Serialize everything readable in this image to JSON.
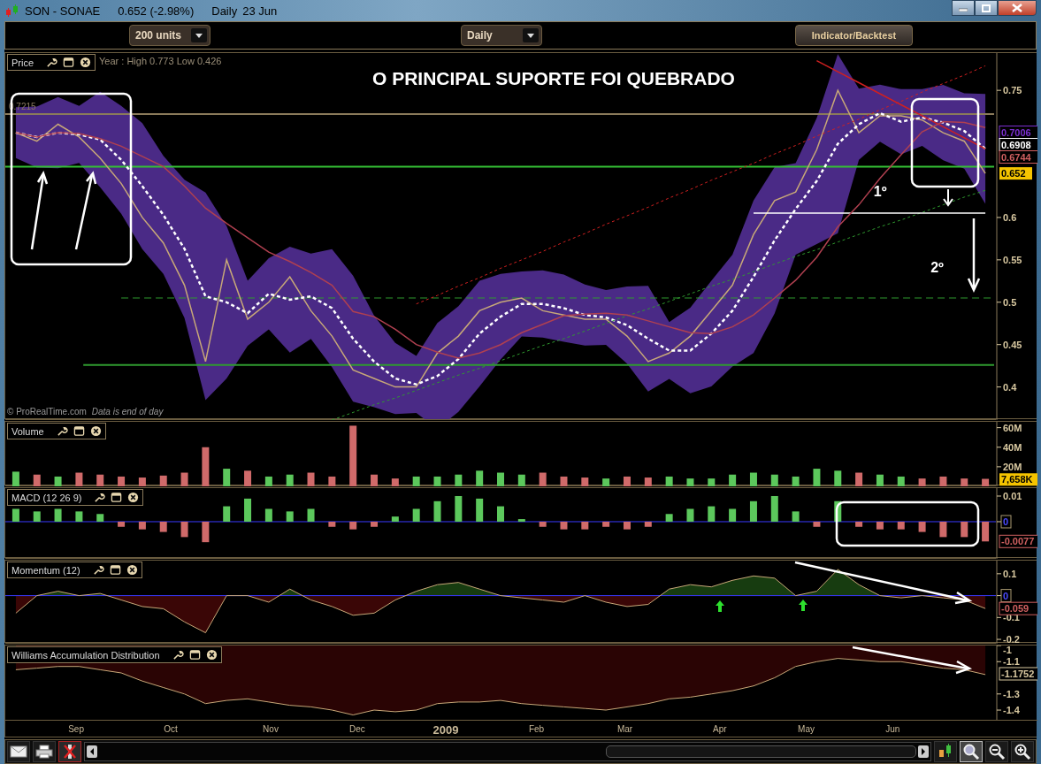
{
  "window": {
    "title": "SON - SONAE",
    "quote": "0.652 (-2.98%)",
    "period": "Daily",
    "date": "23 Jun"
  },
  "toolbar": {
    "units_dropdown": "200 units",
    "period_dropdown": "Daily",
    "indicator_button": "Indicator/Backtest"
  },
  "price_panel": {
    "info": "Year : High 0.773 Low 0.426",
    "headline": "O PRINCIPAL SUPORTE FOI QUEBRADO",
    "level_label": "0.7215",
    "credit": "© ProRealTime.com",
    "credit_note": "Data is end of day",
    "axis_labels": [
      {
        "text": "0.7006",
        "kind": "outline",
        "color": "#7b2fd0"
      },
      {
        "text": "0.6908",
        "kind": "outline",
        "color": "#ffffff"
      },
      {
        "text": "0.6744",
        "kind": "outline",
        "color": "#d06060"
      },
      {
        "text": "0.652",
        "kind": "filled",
        "color": "#f5c400"
      }
    ],
    "chart_data": {
      "type": "line",
      "ylim": [
        0.361,
        0.794
      ],
      "yticks": [
        0.75,
        0.6,
        0.55,
        0.5,
        0.45,
        0.4
      ],
      "categories": [
        null,
        null,
        null,
        null,
        null,
        null,
        null,
        null,
        null,
        null,
        null,
        null,
        null,
        null,
        null,
        null,
        null,
        null,
        null,
        null,
        null,
        null,
        null,
        null,
        null,
        null,
        null,
        null,
        null,
        null,
        null,
        null,
        null,
        null,
        null,
        null,
        null,
        null,
        null,
        null,
        null,
        null,
        null,
        null,
        null,
        null,
        null
      ],
      "series": [
        {
          "name": "Price",
          "color": "#c8a878",
          "values": [
            0.7,
            0.69,
            0.71,
            0.695,
            0.67,
            0.64,
            0.6,
            0.57,
            0.52,
            0.43,
            0.55,
            0.48,
            0.5,
            0.53,
            0.49,
            0.46,
            0.42,
            0.41,
            0.4,
            0.4,
            0.44,
            0.46,
            0.49,
            0.5,
            0.505,
            0.49,
            0.485,
            0.48,
            0.48,
            0.46,
            0.43,
            0.44,
            0.46,
            0.49,
            0.52,
            0.58,
            0.62,
            0.63,
            0.68,
            0.75,
            0.7,
            0.72,
            0.72,
            0.715,
            0.7,
            0.69,
            0.652
          ]
        },
        {
          "color": "#ffffff",
          "line_style": "dashed",
          "values": [
            0.7,
            0.695,
            0.7,
            0.698,
            0.692,
            0.668,
            0.637,
            0.603,
            0.563,
            0.507,
            0.5,
            0.487,
            0.51,
            0.503,
            0.507,
            0.493,
            0.457,
            0.43,
            0.41,
            0.403,
            0.413,
            0.433,
            0.463,
            0.483,
            0.498,
            0.498,
            0.493,
            0.485,
            0.482,
            0.473,
            0.457,
            0.443,
            0.443,
            0.463,
            0.49,
            0.53,
            0.573,
            0.61,
            0.643,
            0.687,
            0.71,
            0.723,
            0.713,
            0.718,
            0.712,
            0.702,
            0.681
          ]
        },
        {
          "color": "#d02020",
          "line_style": "dotted",
          "values": [
            null,
            null,
            null,
            null,
            null,
            null,
            null,
            null,
            null,
            null,
            null,
            null,
            null,
            null,
            null,
            null,
            null,
            null,
            null,
            0.498,
            0.508,
            0.519,
            0.529,
            0.54,
            0.55,
            0.56,
            0.571,
            0.581,
            0.592,
            0.602,
            0.612,
            0.623,
            0.633,
            0.644,
            0.654,
            0.664,
            0.675,
            0.685,
            0.696,
            0.706,
            0.716,
            0.727,
            0.737,
            0.748,
            0.758,
            0.768,
            0.779
          ]
        },
        {
          "color": "#2f9a2f",
          "line_style": "dotted",
          "values": [
            null,
            null,
            null,
            null,
            null,
            null,
            null,
            null,
            null,
            null,
            null,
            null,
            null,
            null,
            null,
            0.361,
            0.37,
            0.379,
            0.387,
            0.396,
            0.405,
            0.414,
            0.422,
            0.431,
            0.44,
            0.449,
            0.457,
            0.466,
            0.475,
            0.484,
            0.492,
            0.501,
            0.51,
            0.519,
            0.527,
            0.536,
            0.545,
            0.554,
            0.562,
            0.571,
            0.58,
            0.589,
            0.597,
            0.606,
            0.615,
            0.624,
            0.632
          ]
        },
        {
          "color": "#d02020",
          "line_style": "solid",
          "values": [
            null,
            null,
            null,
            null,
            null,
            null,
            null,
            null,
            null,
            null,
            null,
            null,
            null,
            null,
            null,
            null,
            null,
            null,
            null,
            null,
            null,
            null,
            null,
            null,
            null,
            null,
            null,
            null,
            null,
            null,
            null,
            null,
            null,
            null,
            null,
            null,
            null,
            null,
            0.785,
            0.772,
            0.759,
            0.746,
            0.733,
            0.72,
            0.707,
            0.694,
            0.681
          ]
        },
        {
          "color": "#ffffff",
          "line_style": "solid",
          "values": [
            null,
            null,
            null,
            null,
            null,
            null,
            null,
            null,
            null,
            null,
            null,
            null,
            null,
            null,
            null,
            null,
            null,
            null,
            null,
            null,
            null,
            null,
            null,
            null,
            null,
            null,
            null,
            null,
            null,
            null,
            null,
            null,
            null,
            null,
            null,
            0.605,
            0.605,
            0.605,
            0.605,
            0.605,
            0.605,
            0.605,
            0.605,
            0.605,
            0.605,
            0.605,
            0.605
          ]
        },
        {
          "color": "#b04050",
          "line_style": "solid",
          "values": [
            0.7,
            0.695,
            0.7,
            0.699,
            0.693,
            0.684,
            0.672,
            0.66,
            0.637,
            0.611,
            0.593,
            0.576,
            0.559,
            0.548,
            0.535,
            0.52,
            0.489,
            0.483,
            0.468,
            0.45,
            0.441,
            0.434,
            0.44,
            0.45,
            0.464,
            0.474,
            0.484,
            0.486,
            0.487,
            0.485,
            0.478,
            0.471,
            0.464,
            0.463,
            0.471,
            0.485,
            0.505,
            0.526,
            0.553,
            0.589,
            0.615,
            0.646,
            0.674,
            0.701,
            0.713,
            0.712,
            0.706
          ]
        }
      ],
      "ref_lines": [
        {
          "axis": "y",
          "value": 0.722,
          "color": "#8a7a5a"
        },
        {
          "axis": "y",
          "value": 0.66,
          "color": "#35c035"
        },
        {
          "axis": "y",
          "value": 0.505,
          "color": "#2f9a2f",
          "line_style": "dashed"
        },
        {
          "axis": "y",
          "value": 0.426,
          "color": "#2f9a2f"
        }
      ],
      "annotations": [
        "1º",
        "2º"
      ]
    }
  },
  "volume_panel": {
    "axis_labels": [
      {
        "text": "7,658K",
        "kind": "filled",
        "color": "#f5c400"
      }
    ],
    "chart_data": {
      "type": "bar",
      "ylim": [
        0,
        66
      ],
      "yticks": [
        {
          "value": 60,
          "label": "60M"
        },
        {
          "value": 40,
          "label": "40M"
        },
        {
          "value": 20,
          "label": "20M"
        }
      ],
      "categories": [
        null,
        null,
        null,
        null,
        null,
        null,
        null,
        null,
        null,
        null,
        null,
        null,
        null,
        null,
        null,
        null,
        null,
        null,
        null,
        null,
        null,
        null,
        null,
        null,
        null,
        null,
        null,
        null,
        null,
        null,
        null,
        null,
        null,
        null,
        null,
        null,
        null,
        null,
        null,
        null,
        null,
        null,
        null,
        null,
        null,
        null,
        null
      ],
      "series": [
        {
          "name": "Volume",
          "values": [
            15,
            12,
            10,
            14,
            12,
            10,
            9,
            11,
            14,
            40,
            18,
            16,
            10,
            12,
            14,
            10,
            62,
            12,
            8,
            10,
            10,
            12,
            16,
            14,
            12,
            14,
            10,
            9,
            8,
            10,
            9,
            10,
            8,
            8,
            12,
            14,
            12,
            10,
            18,
            16,
            14,
            12,
            10,
            8,
            10,
            8,
            7.658
          ]
        }
      ]
    }
  },
  "macd_panel": {
    "axis_labels": [
      {
        "text": "-0.0077",
        "kind": "outline",
        "color": "#d06060"
      }
    ],
    "chart_data": {
      "type": "bar",
      "ylim": [
        -0.0145,
        0.0131
      ],
      "yticks": [
        0.01,
        0
      ],
      "ref_lines": [
        {
          "axis": "y",
          "value": 0,
          "color": "#3a3aff"
        }
      ],
      "categories": [
        null,
        null,
        null,
        null,
        null,
        null,
        null,
        null,
        null,
        null,
        null,
        null,
        null,
        null,
        null,
        null,
        null,
        null,
        null,
        null,
        null,
        null,
        null,
        null,
        null,
        null,
        null,
        null,
        null,
        null,
        null,
        null,
        null,
        null,
        null,
        null,
        null,
        null,
        null,
        null,
        null,
        null,
        null,
        null,
        null,
        null,
        null
      ],
      "series": [
        {
          "name": "MACD (12 26 9)",
          "values": [
            0.005,
            0.004,
            0.005,
            0.004,
            0.003,
            -0.002,
            -0.003,
            -0.004,
            -0.006,
            -0.008,
            0.006,
            0.009,
            0.005,
            0.004,
            0.005,
            -0.002,
            -0.003,
            -0.002,
            0.002,
            0.005,
            0.008,
            0.01,
            0.009,
            0.006,
            0.001,
            -0.002,
            -0.003,
            -0.003,
            -0.002,
            -0.003,
            -0.002,
            0.003,
            0.005,
            0.006,
            0.005,
            0.008,
            0.01,
            0.004,
            -0.002,
            0.008,
            -0.002,
            -0.003,
            -0.003,
            -0.004,
            -0.006,
            -0.006,
            -0.0077
          ]
        }
      ]
    }
  },
  "momentum_panel": {
    "axis_labels": [
      {
        "text": "-0.059",
        "kind": "outline",
        "color": "#d06060"
      }
    ],
    "chart_data": {
      "type": "area",
      "ylim": [
        -0.22,
        0.16
      ],
      "yticks": [
        0.1,
        0,
        -0.1,
        -0.2
      ],
      "ref_lines": [
        {
          "axis": "y",
          "value": 0,
          "color": "#3a3aff"
        }
      ],
      "categories": [
        null,
        null,
        null,
        null,
        null,
        null,
        null,
        null,
        null,
        null,
        null,
        null,
        null,
        null,
        null,
        null,
        null,
        null,
        null,
        null,
        null,
        null,
        null,
        null,
        null,
        null,
        null,
        null,
        null,
        null,
        null,
        null,
        null,
        null,
        null,
        null,
        null,
        null,
        null,
        null,
        null,
        null,
        null,
        null,
        null,
        null,
        null
      ],
      "series": [
        {
          "name": "Momentum (12)",
          "values": [
            -0.08,
            0.0,
            0.02,
            0.0,
            0.01,
            -0.02,
            -0.05,
            -0.06,
            -0.12,
            -0.17,
            0.0,
            0.0,
            -0.03,
            0.03,
            -0.02,
            -0.05,
            -0.09,
            -0.08,
            -0.02,
            0.02,
            0.05,
            0.06,
            0.03,
            0.0,
            -0.01,
            -0.02,
            -0.03,
            0.0,
            -0.03,
            -0.05,
            -0.04,
            0.03,
            0.05,
            0.04,
            0.07,
            0.09,
            0.08,
            0.0,
            0.02,
            0.12,
            0.05,
            0.0,
            -0.01,
            0.0,
            -0.01,
            -0.02,
            -0.059
          ]
        }
      ]
    }
  },
  "williams_panel": {
    "axis_labels": [
      {
        "text": "-1.1752",
        "kind": "outline",
        "color": "#d8c8a0"
      }
    ],
    "chart_data": {
      "type": "area",
      "ylim": [
        -1.46,
        -1.0
      ],
      "yticks": [
        -1,
        -1.1,
        -1.3,
        -1.4
      ],
      "categories": [
        null,
        null,
        null,
        null,
        null,
        null,
        null,
        null,
        null,
        null,
        null,
        null,
        null,
        null,
        null,
        null,
        null,
        null,
        null,
        null,
        null,
        null,
        null,
        null,
        null,
        null,
        null,
        null,
        null,
        null,
        null,
        null,
        null,
        null,
        null,
        null,
        null,
        null,
        null,
        null,
        null,
        null,
        null,
        null,
        null,
        null,
        null
      ],
      "series": [
        {
          "name": "Williams Accumulation Distribution",
          "values": [
            -1.15,
            -1.14,
            -1.13,
            -1.13,
            -1.15,
            -1.17,
            -1.22,
            -1.26,
            -1.3,
            -1.36,
            -1.34,
            -1.33,
            -1.35,
            -1.37,
            -1.38,
            -1.4,
            -1.43,
            -1.4,
            -1.41,
            -1.4,
            -1.36,
            -1.35,
            -1.35,
            -1.34,
            -1.36,
            -1.37,
            -1.38,
            -1.39,
            -1.4,
            -1.38,
            -1.36,
            -1.33,
            -1.32,
            -1.3,
            -1.28,
            -1.25,
            -1.2,
            -1.13,
            -1.1,
            -1.08,
            -1.09,
            -1.1,
            -1.1,
            -1.12,
            -1.14,
            -1.15,
            -1.18
          ]
        }
      ]
    }
  },
  "time_axis": [
    {
      "label": "Sep",
      "kind": "month"
    },
    {
      "label": "Oct",
      "kind": "month"
    },
    {
      "label": "Nov",
      "kind": "month"
    },
    {
      "label": "Dec",
      "kind": "month"
    },
    {
      "label": "2009",
      "kind": "year"
    },
    {
      "label": "Feb",
      "kind": "month"
    },
    {
      "label": "Mar",
      "kind": "month"
    },
    {
      "label": "Apr",
      "kind": "month"
    },
    {
      "label": "May",
      "kind": "month"
    },
    {
      "label": "Jun",
      "kind": "month"
    }
  ]
}
